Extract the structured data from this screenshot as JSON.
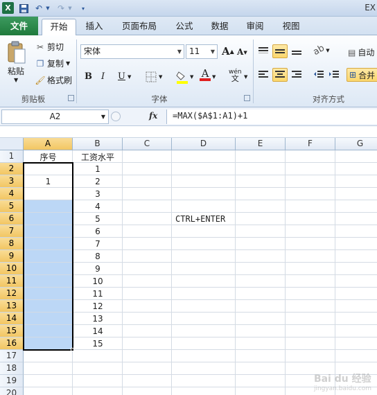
{
  "window": {
    "title_fragment": "EX"
  },
  "quick_access": {
    "logo": "X",
    "icons": [
      "save-icon",
      "undo-icon",
      "redo-icon",
      "customize-icon"
    ]
  },
  "tabs": [
    {
      "label": "文件"
    },
    {
      "label": "开始"
    },
    {
      "label": "插入"
    },
    {
      "label": "页面布局"
    },
    {
      "label": "公式"
    },
    {
      "label": "数据"
    },
    {
      "label": "审阅"
    },
    {
      "label": "视图"
    }
  ],
  "active_tab": "开始",
  "clipboard": {
    "paste_label": "粘贴",
    "cut_label": "剪切",
    "copy_label": "复制",
    "format_painter_label": "格式刷",
    "group_label": "剪贴板"
  },
  "font": {
    "font_name": "宋体",
    "font_size": "11",
    "bold": "B",
    "italic": "I",
    "underline": "U",
    "font_color_glyph": "A",
    "phonetic_glyph": "wén",
    "grow_glyph": "A",
    "shrink_glyph": "A",
    "group_label": "字体"
  },
  "alignment": {
    "wrap_label": "自动",
    "merge_label": "合并",
    "group_label": "对齐方式"
  },
  "formula_bar": {
    "name_box": "A2",
    "fx": "fx",
    "formula": "=MAX($A$1:A1)+1"
  },
  "sheet": {
    "columns": [
      "A",
      "B",
      "C",
      "D",
      "E",
      "F",
      "G"
    ],
    "selected_column": "A",
    "rows": [
      "1",
      "2",
      "3",
      "4",
      "5",
      "6",
      "7",
      "8",
      "9",
      "10",
      "11",
      "12",
      "13",
      "14",
      "15",
      "16",
      "17",
      "18",
      "19",
      "20"
    ],
    "selected_rows": [
      "2",
      "3",
      "4",
      "5",
      "6",
      "7",
      "8",
      "9",
      "10",
      "11",
      "12",
      "13",
      "14",
      "15",
      "16"
    ],
    "cells": {
      "A1": "序号",
      "B1": "工资水平",
      "A3": "1",
      "B2": "1",
      "B3": "2",
      "B4": "3",
      "B5": "4",
      "B6": "5",
      "B7": "6",
      "B8": "7",
      "B9": "8",
      "B10": "9",
      "B11": "10",
      "B12": "11",
      "B13": "12",
      "B14": "13",
      "B15": "14",
      "B16": "15",
      "D6": "CTRL+ENTER"
    }
  },
  "watermark": {
    "brand": "Bai du 经验",
    "url": "jingyan.baidu.com"
  },
  "colors": {
    "file_tab": "#1f7a3c",
    "selection_fill": "#bcd7f6",
    "header_highlight": "#f2c662"
  }
}
